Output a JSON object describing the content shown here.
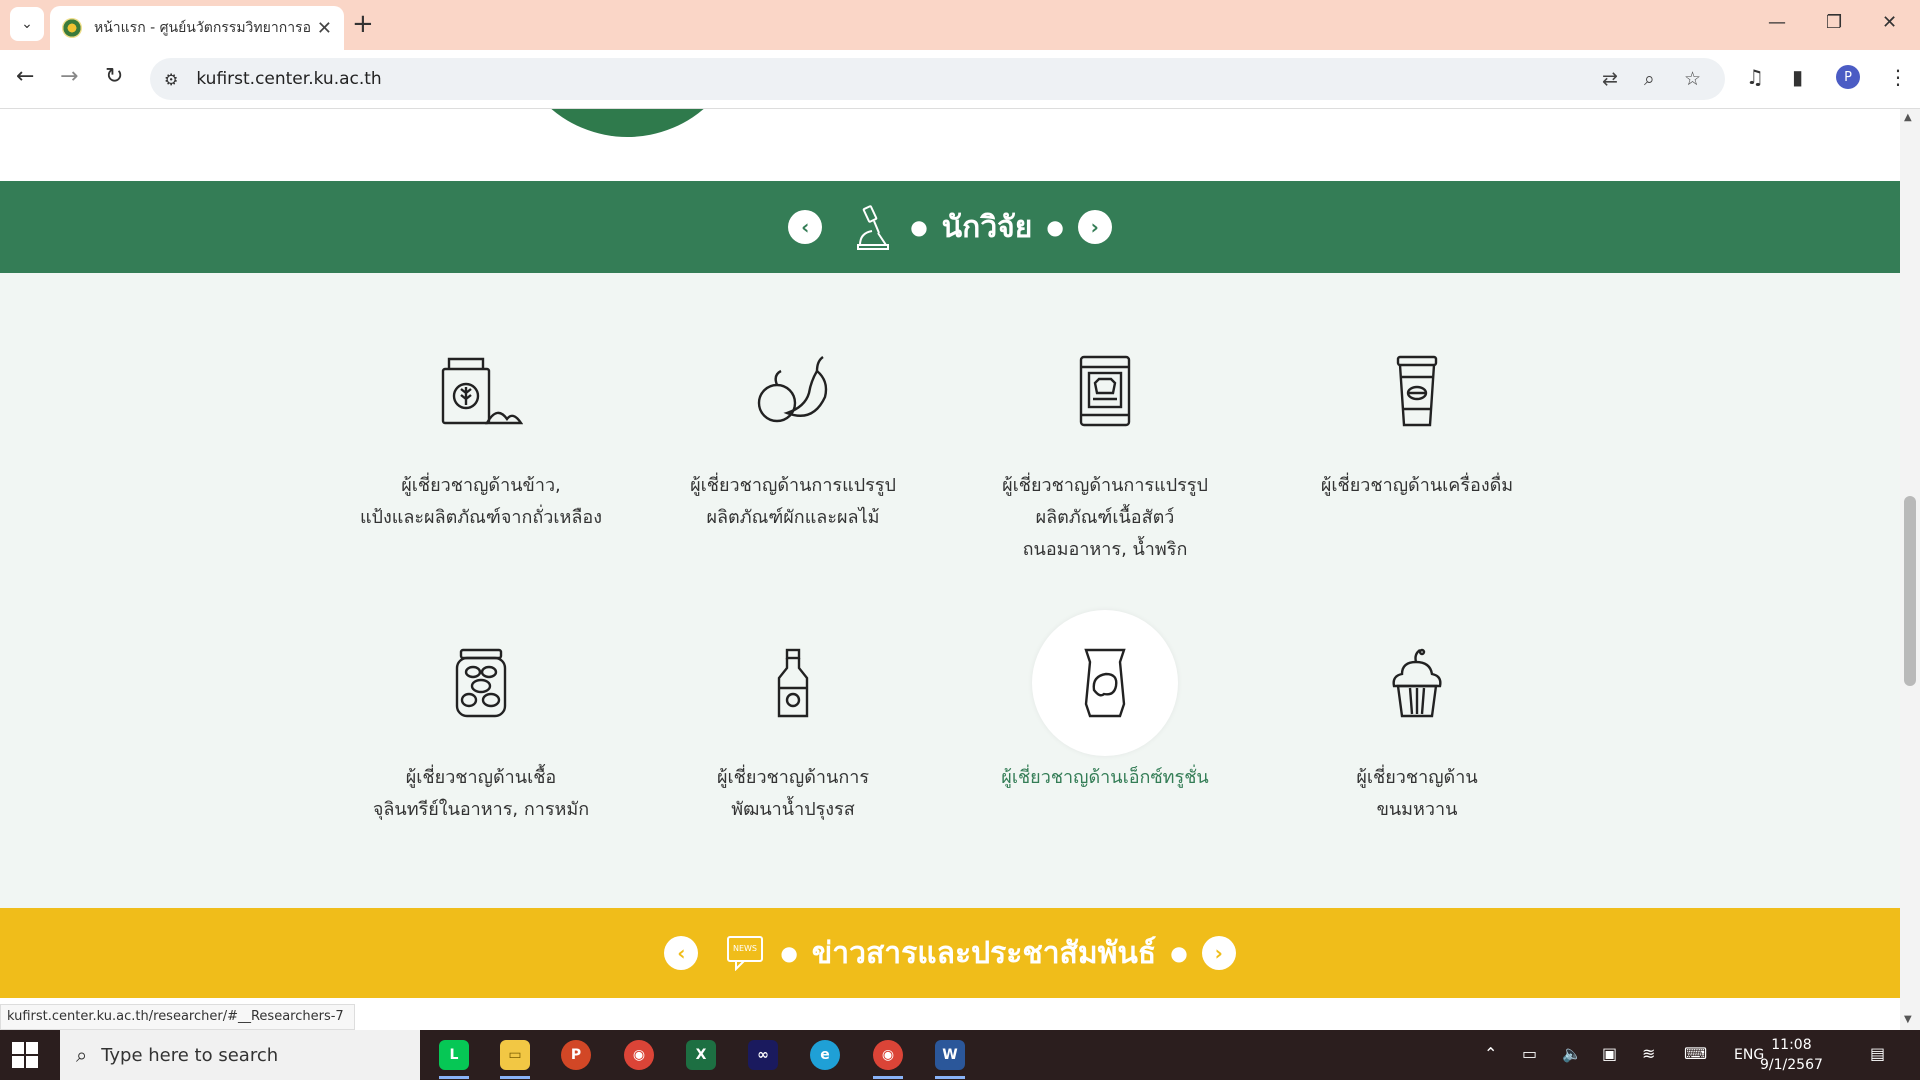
{
  "browser": {
    "tab_title": "หน้าแรก - ศูนย์นวัตกรรมวิทยาการอ",
    "url": "kufirst.center.ku.ac.th",
    "status_url": "kufirst.center.ku.ac.th/researcher/#__Researchers-7",
    "profile_initial": "P"
  },
  "researcher_section": {
    "title": "นักวิจัย",
    "cards": [
      {
        "lines": [
          "ผู้เชี่ยวชาญด้านข้าว,",
          "แป้งและผลิตภัณฑ์จากถั่วเหลือง"
        ],
        "icon": "rice-sack-icon"
      },
      {
        "lines": [
          "ผู้เชี่ยวชาญด้านการแปรรูป",
          "ผลิตภัณฑ์ผักและผลไม้"
        ],
        "icon": "fruit-vegetable-icon"
      },
      {
        "lines": [
          "ผู้เชี่ยวชาญด้านการแปรรูป",
          "ผลิตภัณฑ์เนื้อสัตว์",
          "ถนอมอาหาร, น้ำพริก"
        ],
        "icon": "canned-meat-icon"
      },
      {
        "lines": [
          "ผู้เชี่ยวชาญด้านเครื่องดื่ม"
        ],
        "icon": "coffee-cup-icon"
      },
      {
        "lines": [
          "ผู้เชี่ยวชาญด้านเชื้อ",
          "จุลินทรีย์ในอาหาร, การหมัก"
        ],
        "icon": "fermentation-jar-icon"
      },
      {
        "lines": [
          "ผู้เชี่ยวชาญด้านการ",
          "พัฒนาน้ำปรุงรส"
        ],
        "icon": "sauce-bottle-icon"
      },
      {
        "lines": [
          "ผู้เชี่ยวชาญด้านเอ็กซ์ทรูชั่น"
        ],
        "icon": "snack-bag-icon"
      },
      {
        "lines": [
          "ผู้เชี่ยวชาญด้าน",
          "ขนมหวาน"
        ],
        "icon": "cupcake-icon"
      }
    ]
  },
  "news_section": {
    "title": "ข่าวสารและประชาสัมพันธ์",
    "news_badge": "NEWS"
  },
  "taskbar": {
    "search_placeholder": "Type here to search",
    "language": "ENG",
    "time": "11:08",
    "date": "9/1/2567"
  },
  "colors": {
    "green": "#347d56",
    "yellow": "#f0bd1a",
    "tab_bar": "#fad6c7"
  }
}
